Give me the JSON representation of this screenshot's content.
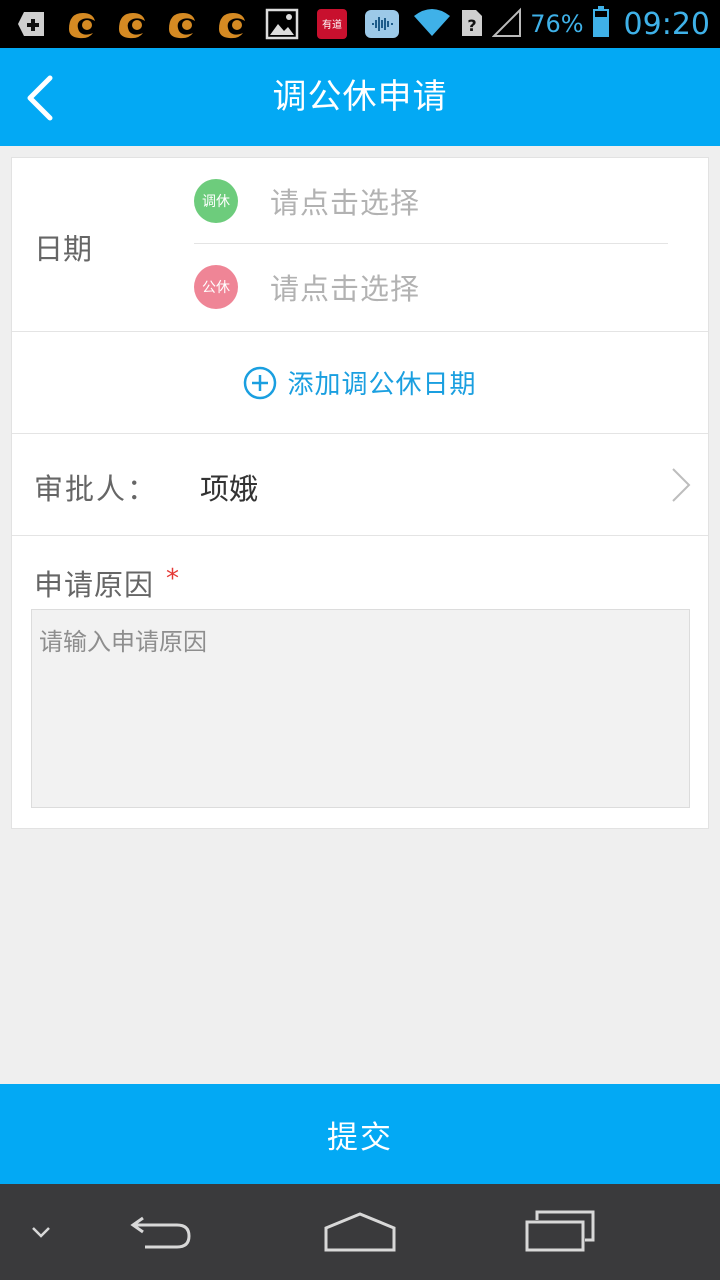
{
  "status_bar": {
    "icons": [
      "add-notification-icon",
      "uc-browser-icon",
      "uc-browser-icon",
      "uc-browser-icon",
      "uc-browser-icon",
      "gallery-icon",
      "youdao-icon",
      "voice-assistant-icon"
    ],
    "youdao_text": "有道",
    "battery_percent": "76%",
    "time": "09:20",
    "accent_color": "#3fb1e8"
  },
  "header": {
    "title": "调公休申请",
    "back_icon": "chevron-left-icon",
    "color": "#03a9f4"
  },
  "form": {
    "date_label": "日期",
    "dates": [
      {
        "badge": "调休",
        "badge_color": "#6dcc7c",
        "placeholder": "请点击选择"
      },
      {
        "badge": "公休",
        "badge_color": "#ef8596",
        "placeholder": "请点击选择"
      }
    ],
    "add_date_label": "添加调公休日期",
    "approver_label": "审批人：",
    "approver_name": "项娥",
    "reason_label": "申请原因",
    "required_mark": "*",
    "reason_placeholder": "请输入申请原因",
    "reason_value": ""
  },
  "submit_label": "提交",
  "nav_bar": {
    "buttons": [
      "hide-keyboard-icon",
      "back-icon",
      "home-icon",
      "recent-apps-icon"
    ]
  }
}
